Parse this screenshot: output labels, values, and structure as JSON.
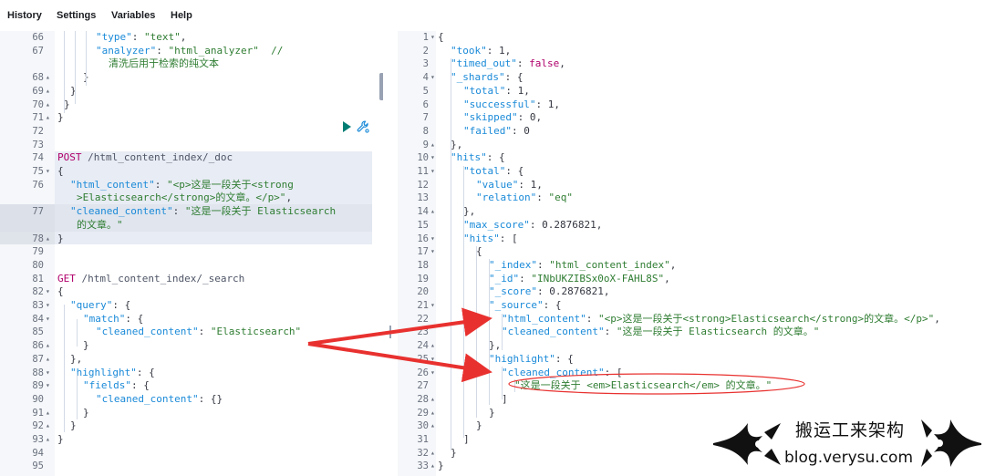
{
  "menu": [
    "History",
    "Settings",
    "Variables",
    "Help"
  ],
  "left_editor": {
    "lines": [
      {
        "n": "66",
        "fold": "",
        "segs": [
          [
            "k",
            "\"type\""
          ],
          [
            "p",
            ": "
          ],
          [
            "s",
            "\"text\""
          ],
          [
            "p",
            ","
          ]
        ],
        "indent": 3
      },
      {
        "n": "67",
        "fold": "",
        "segs": [
          [
            "k",
            "\"analyzer\""
          ],
          [
            "p",
            ": "
          ],
          [
            "s",
            "\"html_analyzer\""
          ],
          [
            "p",
            "  "
          ],
          [
            "s",
            "//"
          ]
        ],
        "indent": 3
      },
      {
        "n": "",
        "fold": "",
        "segs": [
          [
            "s",
            "清洗后用于检索的纯文本"
          ]
        ],
        "indent": 4
      },
      {
        "n": "68",
        "fold": "▴",
        "segs": [
          [
            "p",
            "}"
          ]
        ],
        "indent": 2
      },
      {
        "n": "69",
        "fold": "▴",
        "segs": [
          [
            "p",
            "}"
          ]
        ],
        "indent": 1
      },
      {
        "n": "70",
        "fold": "▴",
        "segs": [
          [
            "p",
            "}"
          ]
        ],
        "indent": 0.5
      },
      {
        "n": "71",
        "fold": "▴",
        "segs": [
          [
            "p",
            "}"
          ]
        ],
        "indent": 0
      },
      {
        "n": "72",
        "fold": "",
        "segs": [],
        "indent": 0
      },
      {
        "n": "73",
        "fold": "",
        "segs": [],
        "indent": 0
      },
      {
        "n": "74",
        "fold": "",
        "segs": [
          [
            "kw",
            "POST"
          ],
          [
            "url",
            " /html_content_index/_doc"
          ]
        ],
        "indent": 0
      },
      {
        "n": "75",
        "fold": "▾",
        "segs": [
          [
            "p",
            "{"
          ]
        ],
        "indent": 0
      },
      {
        "n": "76",
        "fold": "",
        "segs": [
          [
            "k",
            "\"html_content\""
          ],
          [
            "p",
            ": "
          ],
          [
            "s",
            "\"<p>这是一段关于<strong"
          ]
        ],
        "indent": 1
      },
      {
        "n": "",
        "fold": "",
        "segs": [
          [
            "s",
            ">Elasticsearch</strong>的文章。</p>\""
          ],
          [
            "p",
            ","
          ]
        ],
        "indent": 1.5
      },
      {
        "n": "77",
        "fold": "",
        "segs": [
          [
            "k",
            "\"cleaned_content\""
          ],
          [
            "p",
            ": "
          ],
          [
            "s",
            "\"这是一段关于 Elasticsearch"
          ]
        ],
        "indent": 1
      },
      {
        "n": "",
        "fold": "",
        "segs": [
          [
            "s",
            "的文章。\""
          ]
        ],
        "indent": 1.5
      },
      {
        "n": "78",
        "fold": "▴",
        "segs": [
          [
            "p",
            "}"
          ]
        ],
        "indent": 0
      },
      {
        "n": "79",
        "fold": "",
        "segs": [],
        "indent": 0
      },
      {
        "n": "80",
        "fold": "",
        "segs": [],
        "indent": 0
      },
      {
        "n": "81",
        "fold": "",
        "segs": [
          [
            "kw",
            "GET"
          ],
          [
            "url",
            " /html_content_index/_search"
          ]
        ],
        "indent": 0
      },
      {
        "n": "82",
        "fold": "▾",
        "segs": [
          [
            "p",
            "{"
          ]
        ],
        "indent": 0
      },
      {
        "n": "83",
        "fold": "▾",
        "segs": [
          [
            "k",
            "\"query\""
          ],
          [
            "p",
            ": {"
          ]
        ],
        "indent": 1
      },
      {
        "n": "84",
        "fold": "▾",
        "segs": [
          [
            "k",
            "\"match\""
          ],
          [
            "p",
            ": {"
          ]
        ],
        "indent": 2
      },
      {
        "n": "85",
        "fold": "",
        "segs": [
          [
            "k",
            "\"cleaned_content\""
          ],
          [
            "p",
            ": "
          ],
          [
            "s",
            "\"Elasticsearch\""
          ]
        ],
        "indent": 3
      },
      {
        "n": "86",
        "fold": "▴",
        "segs": [
          [
            "p",
            "}"
          ]
        ],
        "indent": 2
      },
      {
        "n": "87",
        "fold": "▴",
        "segs": [
          [
            "p",
            "},"
          ]
        ],
        "indent": 1
      },
      {
        "n": "88",
        "fold": "▾",
        "segs": [
          [
            "k",
            "\"highlight\""
          ],
          [
            "p",
            ": {"
          ]
        ],
        "indent": 1
      },
      {
        "n": "89",
        "fold": "▾",
        "segs": [
          [
            "k",
            "\"fields\""
          ],
          [
            "p",
            ": {"
          ]
        ],
        "indent": 2
      },
      {
        "n": "90",
        "fold": "",
        "segs": [
          [
            "k",
            "\"cleaned_content\""
          ],
          [
            "p",
            ": {}"
          ]
        ],
        "indent": 3
      },
      {
        "n": "91",
        "fold": "▴",
        "segs": [
          [
            "p",
            "}"
          ]
        ],
        "indent": 2
      },
      {
        "n": "92",
        "fold": "▴",
        "segs": [
          [
            "p",
            "}"
          ]
        ],
        "indent": 1
      },
      {
        "n": "93",
        "fold": "▴",
        "segs": [
          [
            "p",
            "}"
          ]
        ],
        "indent": 0
      },
      {
        "n": "94",
        "fold": "",
        "segs": [],
        "indent": 0
      },
      {
        "n": "95",
        "fold": "",
        "segs": [],
        "indent": 0
      }
    ]
  },
  "right_editor": {
    "lines": [
      {
        "n": "1",
        "fold": "▾",
        "segs": [
          [
            "p",
            "{"
          ]
        ],
        "indent": 0
      },
      {
        "n": "2",
        "fold": "",
        "segs": [
          [
            "k",
            "\"took\""
          ],
          [
            "p",
            ": "
          ],
          [
            "n",
            "1"
          ],
          [
            "p",
            ","
          ]
        ],
        "indent": 1
      },
      {
        "n": "3",
        "fold": "",
        "segs": [
          [
            "k",
            "\"timed_out\""
          ],
          [
            "p",
            ": "
          ],
          [
            "b",
            "false"
          ],
          [
            "p",
            ","
          ]
        ],
        "indent": 1
      },
      {
        "n": "4",
        "fold": "▾",
        "segs": [
          [
            "k",
            "\"_shards\""
          ],
          [
            "p",
            ": {"
          ]
        ],
        "indent": 1
      },
      {
        "n": "5",
        "fold": "",
        "segs": [
          [
            "k",
            "\"total\""
          ],
          [
            "p",
            ": "
          ],
          [
            "n",
            "1"
          ],
          [
            "p",
            ","
          ]
        ],
        "indent": 2
      },
      {
        "n": "6",
        "fold": "",
        "segs": [
          [
            "k",
            "\"successful\""
          ],
          [
            "p",
            ": "
          ],
          [
            "n",
            "1"
          ],
          [
            "p",
            ","
          ]
        ],
        "indent": 2
      },
      {
        "n": "7",
        "fold": "",
        "segs": [
          [
            "k",
            "\"skipped\""
          ],
          [
            "p",
            ": "
          ],
          [
            "n",
            "0"
          ],
          [
            "p",
            ","
          ]
        ],
        "indent": 2
      },
      {
        "n": "8",
        "fold": "",
        "segs": [
          [
            "k",
            "\"failed\""
          ],
          [
            "p",
            ": "
          ],
          [
            "n",
            "0"
          ]
        ],
        "indent": 2
      },
      {
        "n": "9",
        "fold": "▴",
        "segs": [
          [
            "p",
            "},"
          ]
        ],
        "indent": 1
      },
      {
        "n": "10",
        "fold": "▾",
        "segs": [
          [
            "k",
            "\"hits\""
          ],
          [
            "p",
            ": {"
          ]
        ],
        "indent": 1
      },
      {
        "n": "11",
        "fold": "▾",
        "segs": [
          [
            "k",
            "\"total\""
          ],
          [
            "p",
            ": {"
          ]
        ],
        "indent": 2
      },
      {
        "n": "12",
        "fold": "",
        "segs": [
          [
            "k",
            "\"value\""
          ],
          [
            "p",
            ": "
          ],
          [
            "n",
            "1"
          ],
          [
            "p",
            ","
          ]
        ],
        "indent": 3
      },
      {
        "n": "13",
        "fold": "",
        "segs": [
          [
            "k",
            "\"relation\""
          ],
          [
            "p",
            ": "
          ],
          [
            "s",
            "\"eq\""
          ]
        ],
        "indent": 3
      },
      {
        "n": "14",
        "fold": "▴",
        "segs": [
          [
            "p",
            "},"
          ]
        ],
        "indent": 2
      },
      {
        "n": "15",
        "fold": "",
        "segs": [
          [
            "k",
            "\"max_score\""
          ],
          [
            "p",
            ": "
          ],
          [
            "n",
            "0.2876821"
          ],
          [
            "p",
            ","
          ]
        ],
        "indent": 2
      },
      {
        "n": "16",
        "fold": "▾",
        "segs": [
          [
            "k",
            "\"hits\""
          ],
          [
            "p",
            ": ["
          ]
        ],
        "indent": 2
      },
      {
        "n": "17",
        "fold": "▾",
        "segs": [
          [
            "p",
            "{"
          ]
        ],
        "indent": 3
      },
      {
        "n": "18",
        "fold": "",
        "segs": [
          [
            "k",
            "\"_index\""
          ],
          [
            "p",
            ": "
          ],
          [
            "s",
            "\"html_content_index\""
          ],
          [
            "p",
            ","
          ]
        ],
        "indent": 4
      },
      {
        "n": "19",
        "fold": "",
        "segs": [
          [
            "k",
            "\"_id\""
          ],
          [
            "p",
            ": "
          ],
          [
            "s",
            "\"INbUKZIBSx0oX-FAHL8S\""
          ],
          [
            "p",
            ","
          ]
        ],
        "indent": 4
      },
      {
        "n": "20",
        "fold": "",
        "segs": [
          [
            "k",
            "\"_score\""
          ],
          [
            "p",
            ": "
          ],
          [
            "n",
            "0.2876821"
          ],
          [
            "p",
            ","
          ]
        ],
        "indent": 4
      },
      {
        "n": "21",
        "fold": "▾",
        "segs": [
          [
            "k",
            "\"_source\""
          ],
          [
            "p",
            ": {"
          ]
        ],
        "indent": 4
      },
      {
        "n": "22",
        "fold": "",
        "segs": [
          [
            "k",
            "\"html_content\""
          ],
          [
            "p",
            ": "
          ],
          [
            "s",
            "\"<p>这是一段关于<strong>Elasticsearch</strong>的文章。</p>\""
          ],
          [
            "p",
            ","
          ]
        ],
        "indent": 5
      },
      {
        "n": "23",
        "fold": "",
        "segs": [
          [
            "k",
            "\"cleaned_content\""
          ],
          [
            "p",
            ": "
          ],
          [
            "s",
            "\"这是一段关于 Elasticsearch 的文章。\""
          ]
        ],
        "indent": 5
      },
      {
        "n": "24",
        "fold": "▴",
        "segs": [
          [
            "p",
            "},"
          ]
        ],
        "indent": 4
      },
      {
        "n": "25",
        "fold": "▾",
        "segs": [
          [
            "k",
            "\"highlight\""
          ],
          [
            "p",
            ": {"
          ]
        ],
        "indent": 4
      },
      {
        "n": "26",
        "fold": "▾",
        "segs": [
          [
            "k",
            "\"cleaned_content\""
          ],
          [
            "p",
            ": ["
          ]
        ],
        "indent": 5
      },
      {
        "n": "27",
        "fold": "",
        "segs": [
          [
            "s",
            "\"这是一段关于 <em>Elasticsearch</em> 的文章。\""
          ]
        ],
        "indent": 6
      },
      {
        "n": "28",
        "fold": "▴",
        "segs": [
          [
            "p",
            "]"
          ]
        ],
        "indent": 5
      },
      {
        "n": "29",
        "fold": "▴",
        "segs": [
          [
            "p",
            "}"
          ]
        ],
        "indent": 4
      },
      {
        "n": "30",
        "fold": "▴",
        "segs": [
          [
            "p",
            "}"
          ]
        ],
        "indent": 3
      },
      {
        "n": "31",
        "fold": "",
        "segs": [
          [
            "p",
            "]"
          ]
        ],
        "indent": 2
      },
      {
        "n": "32",
        "fold": "▴",
        "segs": [
          [
            "p",
            "}"
          ]
        ],
        "indent": 1
      },
      {
        "n": "33",
        "fold": "▴",
        "segs": [
          [
            "p",
            "}"
          ]
        ],
        "indent": 0
      }
    ]
  },
  "watermark": {
    "title": "搬运工来架构",
    "url": "blog.verysu.com"
  },
  "colors": {
    "key": "#1a8ad8",
    "string": "#2f7d32",
    "method": "#b0006b",
    "arrow": "#e8312f",
    "run": "#017d73"
  },
  "icons": [
    "play-icon",
    "wrench-icon"
  ]
}
